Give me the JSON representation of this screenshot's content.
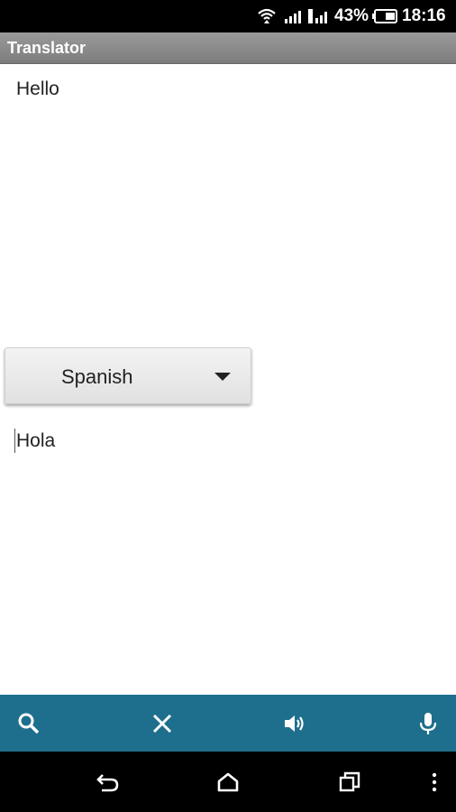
{
  "status_bar": {
    "battery_percent": "43%",
    "time": "18:16",
    "icons": [
      "wifi-icon",
      "signal-icon",
      "signal-icon",
      "battery-icon"
    ]
  },
  "action_bar": {
    "title": "Translator"
  },
  "source": {
    "text": "Hello"
  },
  "language_selector": {
    "selected": "Spanish"
  },
  "result": {
    "text": "Hola"
  },
  "toolbar": {
    "buttons": [
      "search-icon",
      "clear-icon",
      "speaker-icon",
      "microphone-icon"
    ]
  },
  "navigation": {
    "buttons": [
      "back-icon",
      "home-icon",
      "recents-icon",
      "overflow-menu-icon"
    ]
  },
  "colors": {
    "toolbar_bg": "#1e6f8d",
    "action_bar_bg": "#8c8c8c"
  }
}
